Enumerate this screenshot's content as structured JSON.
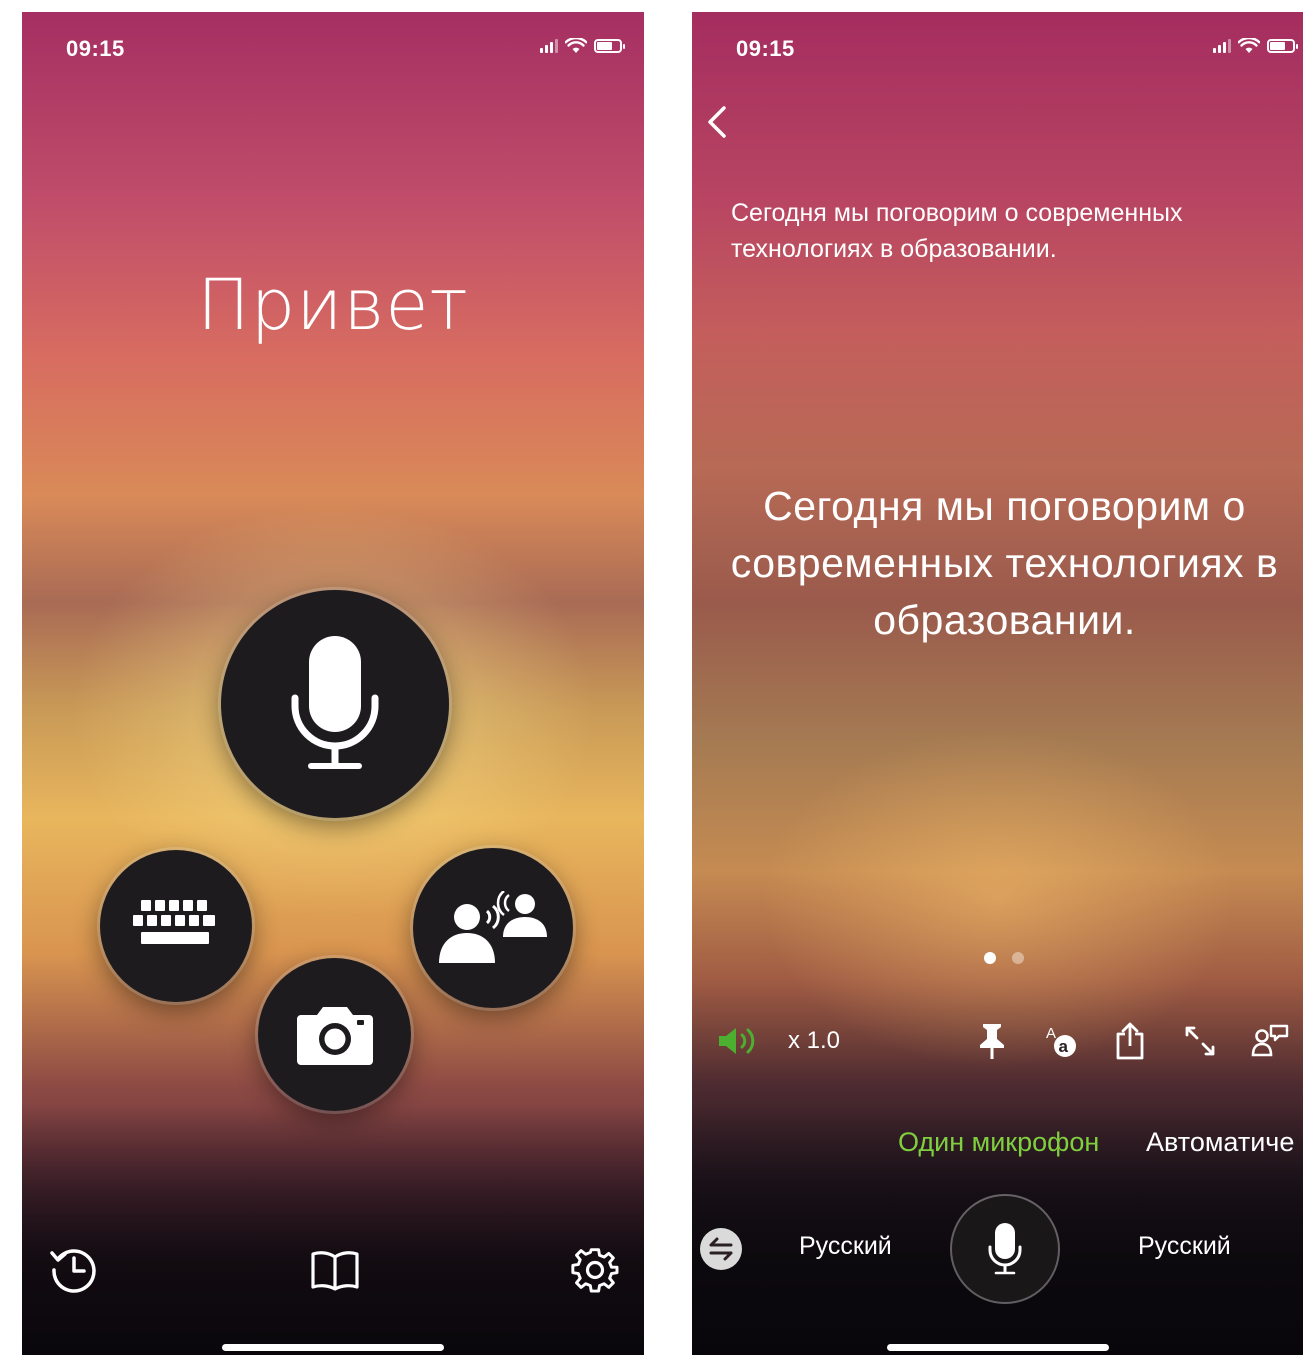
{
  "left_screen": {
    "status": {
      "time": "09:15"
    },
    "greeting": "Привет",
    "buttons": {
      "microphone": "microphone-icon",
      "keyboard": "keyboard-icon",
      "conversation": "conversation-icon",
      "camera": "camera-icon"
    },
    "bottom_nav": {
      "history": "history-icon",
      "phrasebook": "book-icon",
      "settings": "gear-icon"
    }
  },
  "right_screen": {
    "status": {
      "time": "09:15"
    },
    "source_text": "Сегодня мы поговорим о современных технологиях в образовании.",
    "translation_text": "Сегодня мы поговорим о современных технологиях в образовании.",
    "page_indicator": {
      "total": 2,
      "active": 1
    },
    "toolbar": {
      "speed": "x 1.0",
      "speaker_color": "#4caf2f"
    },
    "mode_tabs": {
      "one_mic": "Один микрофон",
      "auto": "Автоматиче",
      "active_color": "#7fcf3f"
    },
    "languages": {
      "source": "Русский",
      "target": "Русский"
    }
  }
}
